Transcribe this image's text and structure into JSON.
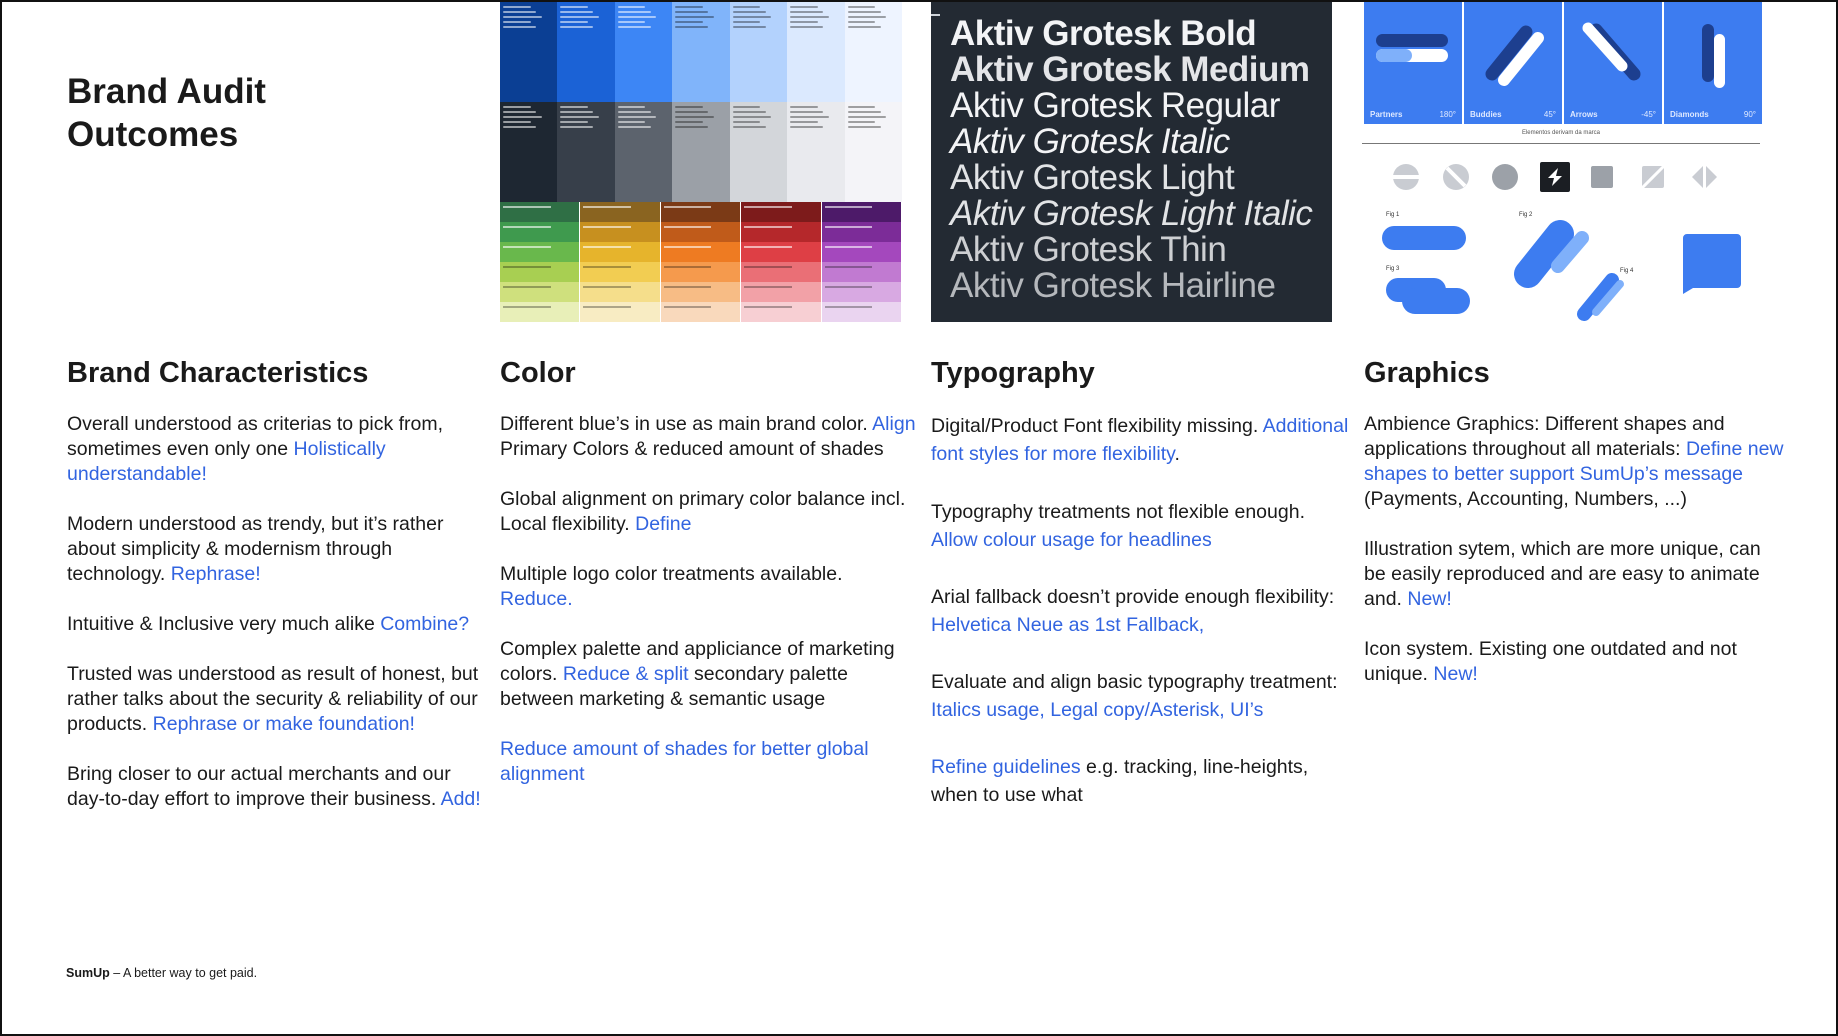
{
  "title": "Brand Audit\nOutcomes",
  "typography_image": {
    "samples": [
      "Aktiv Grotesk Bold",
      "Aktiv Grotesk Medium",
      "Aktiv Grotesk Regular",
      "Aktiv Grotesk Italic",
      "Aktiv Grotesk Light",
      "Aktiv Grotesk Light Italic",
      "Aktiv Grotesk Thin",
      "Aktiv Grotesk Hairline"
    ]
  },
  "graphics_image": {
    "tiles": [
      {
        "label": "Partners",
        "angle": "180°"
      },
      {
        "label": "Buddies",
        "angle": "45°"
      },
      {
        "label": "Arrows",
        "angle": "-45°"
      },
      {
        "label": "Diamonds",
        "angle": "90°"
      }
    ],
    "rule_caption": "Elementos derivam da marca",
    "figures": [
      "Fig 1",
      "Fig 2",
      "Fig 3",
      "Fig 4"
    ],
    "brand_blue": "#3d7cf0"
  },
  "palette_image": {
    "blue_shades": [
      "#0b3f94",
      "#1b62d6",
      "#3d86f5",
      "#80b4fa",
      "#b3d2fd",
      "#dbe9fe",
      "#eef4ff"
    ],
    "gray_shades": [
      "#1e2732",
      "#373f4a",
      "#5c636d",
      "#9ba0a7",
      "#d3d6da",
      "#e9eaee",
      "#f4f4f8"
    ],
    "secondary_columns": [
      [
        "#2f6f45",
        "#3f9a4e",
        "#69b84c",
        "#a8cf52",
        "#cfe07d",
        "#e8efb8"
      ],
      [
        "#8a6420",
        "#c7901f",
        "#e6b42c",
        "#f2cd52",
        "#f5de8b",
        "#f8ecc3"
      ],
      [
        "#7b3a16",
        "#c05b1a",
        "#ee7b22",
        "#f59a4d",
        "#f7bc85",
        "#f9d9bc"
      ],
      [
        "#7d1b1b",
        "#b5282b",
        "#de3f45",
        "#ea6f76",
        "#f2a1a7",
        "#f7cfd3"
      ],
      [
        "#4d1a69",
        "#7c2c98",
        "#a448bd",
        "#c17ad1",
        "#d8a9e2",
        "#ead4f0"
      ]
    ]
  },
  "columns": [
    {
      "heading": "Brand Characteristics",
      "items": [
        {
          "text": "Overall understood as criterias to pick from, sometimes even only one ",
          "link": "Holistically understandable!",
          "after": ""
        },
        {
          "text": "Modern understood as trendy, but it’s rather about simplicity & modernism through technology. ",
          "link": "Rephrase!",
          "after": ""
        },
        {
          "text": "Intuitive & Inclusive very much alike ",
          "link": "Combine?",
          "after": ""
        },
        {
          "text": "Trusted was understood as result of honest, but rather talks about the security & reliability of our products. ",
          "link": "Rephrase or make foundation!",
          "after": ""
        },
        {
          "text": "Bring closer to our actual merchants and our day-to-day effort to improve their business. ",
          "link": "Add!",
          "after": ""
        }
      ]
    },
    {
      "heading": "Color",
      "items": [
        {
          "text": "Different blue’s in use as main brand color. ",
          "link": "Align",
          "after": " Primary Colors & reduced amount of shades"
        },
        {
          "text": "Global alignment on primary color balance incl. Local flexibility. ",
          "link": "Define",
          "after": ""
        },
        {
          "text": "Multiple logo color treatments available. ",
          "link": "Reduce.",
          "after": ""
        },
        {
          "text": "Complex palette and appliciance of marketing colors. ",
          "link": "Reduce & split",
          "after": " secondary palette between marketing & semantic usage"
        },
        {
          "text": "",
          "link": "Reduce amount of shades for better global alignment",
          "after": ""
        }
      ]
    },
    {
      "heading": "Typography",
      "items": [
        {
          "text": "Digital/Product Font flexibility missing. ",
          "link": "Additional font styles for more flexibility",
          "after": "."
        },
        {
          "text": "Typography treatments not flexible enough. ",
          "link": "Allow colour usage for headlines",
          "after": ""
        },
        {
          "text": "Arial fallback doesn’t provide enough flexibility: ",
          "link": "Helvetica Neue as 1st Fallback,",
          "after": ""
        },
        {
          "text": "Evaluate and align basic typography treatment: ",
          "link": "Italics usage, Legal copy/Asterisk, UI’s",
          "after": ""
        },
        {
          "text": "",
          "link": "Refine guidelines",
          "after": " e.g. tracking, line-heights, when to use what"
        }
      ]
    },
    {
      "heading": "Graphics",
      "items": [
        {
          "text": "Ambience Graphics: Different shapes and applications throughout all materials: ",
          "link": "Define new shapes to better support SumUp’s message",
          "after": " (Payments, Accounting, Numbers, ...)"
        },
        {
          "text": "Illustration sytem, which are more unique, can be easily reproduced and are easy to animate and. ",
          "link": "New!",
          "after": ""
        },
        {
          "text": "Icon system. Existing one outdated and not unique. ",
          "link": "New!",
          "after": ""
        }
      ]
    }
  ],
  "footer": {
    "brand": "SumUp",
    "tagline": " – A better way to get paid."
  }
}
